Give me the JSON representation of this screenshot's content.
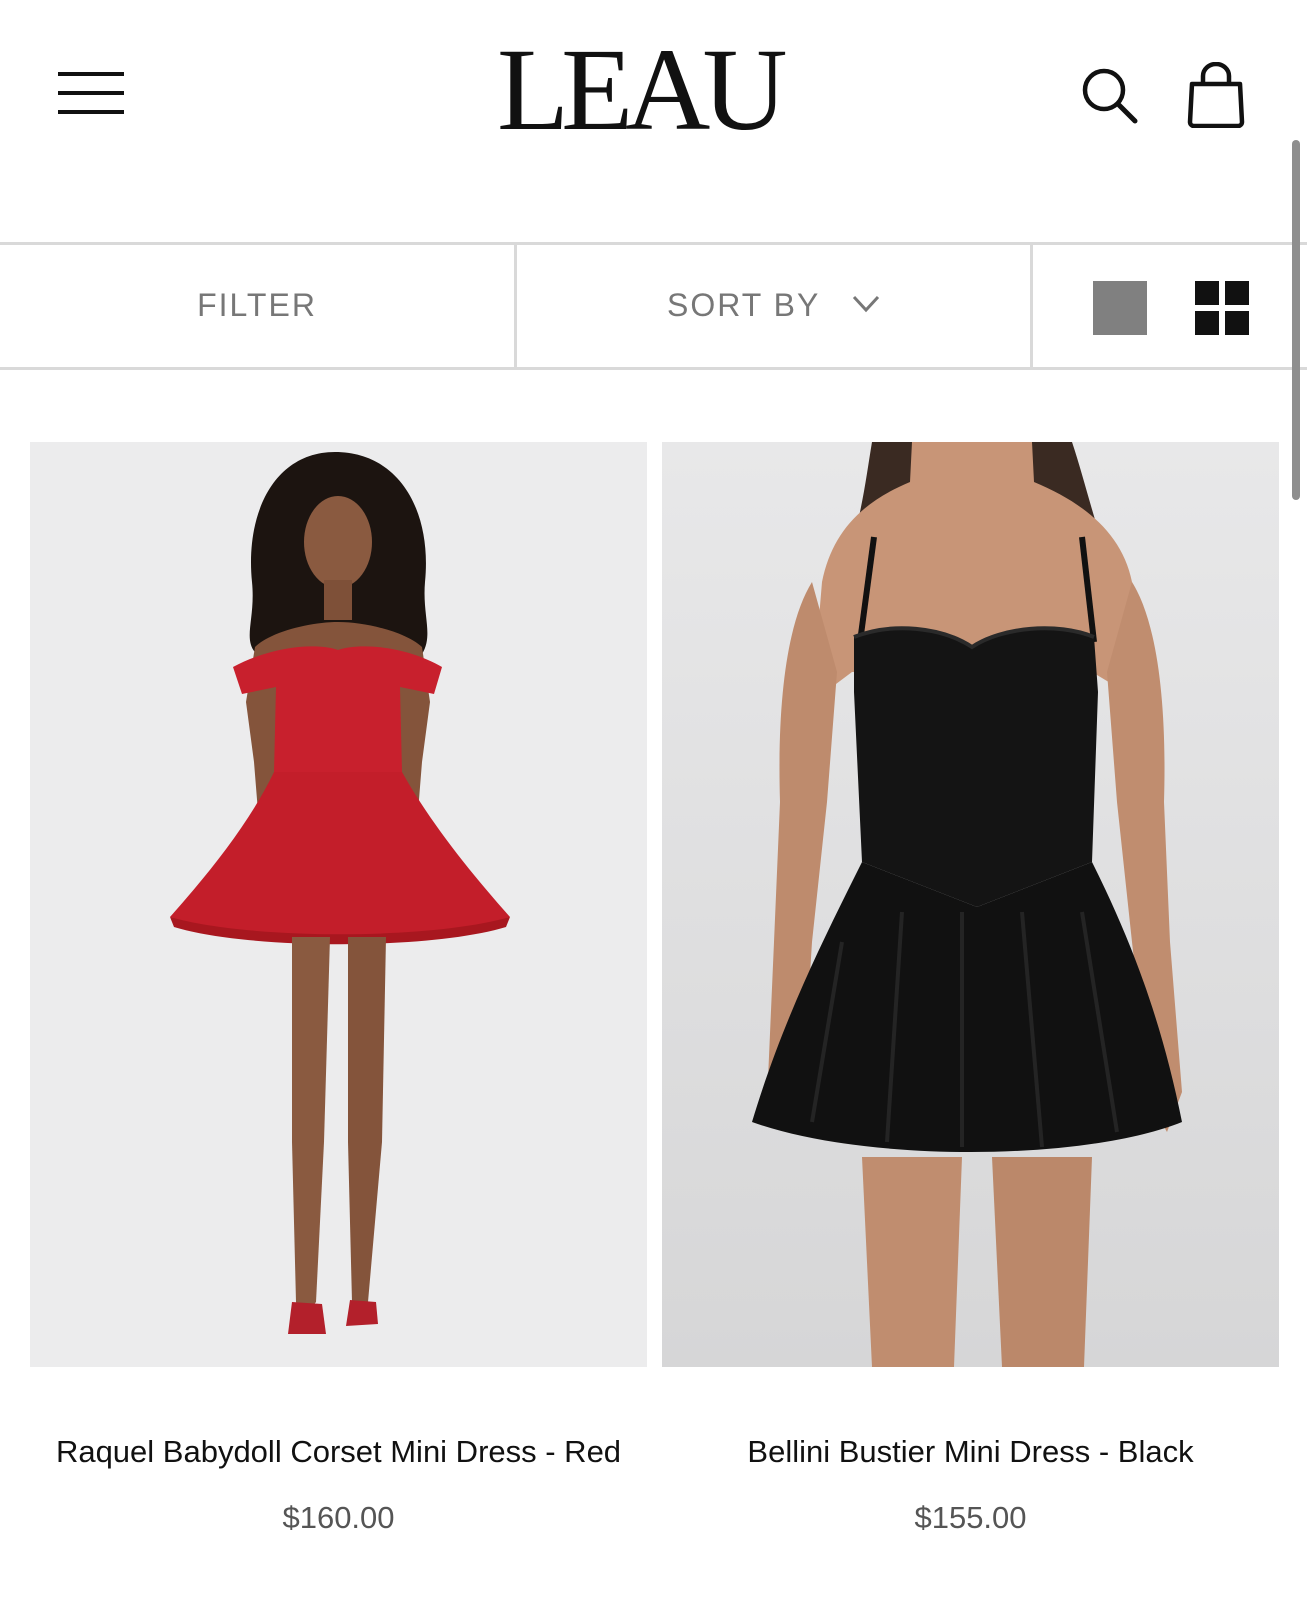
{
  "header": {
    "logo": "LEAU",
    "icons": [
      "menu-icon",
      "search-icon",
      "shopping-bag-icon"
    ]
  },
  "toolbar": {
    "filter_label": "FILTER",
    "sort_label": "SORT BY",
    "view_options": [
      "single-column-view",
      "grid-view"
    ],
    "active_view": "grid-view"
  },
  "products": [
    {
      "name": "Raquel Babydoll Corset Mini Dress - Red",
      "price": "$160.00",
      "dress_color": "#c8202d"
    },
    {
      "name": "Bellini Bustier Mini Dress - Black",
      "price": "$155.00",
      "dress_color": "#111111"
    }
  ]
}
